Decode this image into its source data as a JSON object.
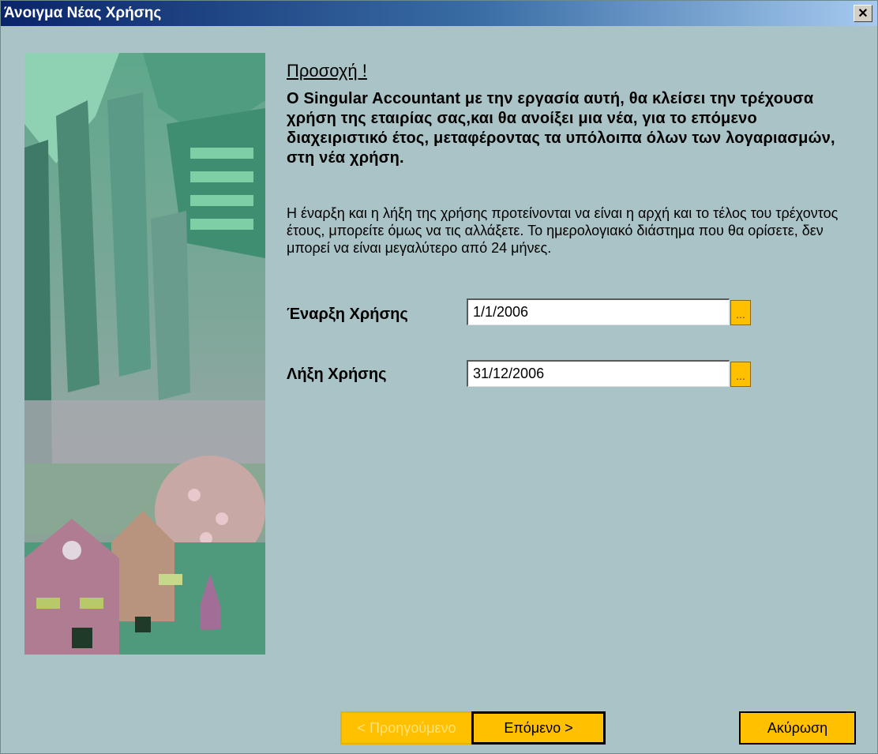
{
  "window": {
    "title": "Άνοιγμα Νέας Χρήσης",
    "close_label": "✕"
  },
  "warning": {
    "title": "Προσοχή !",
    "body": "Ο Singular Accountant με την εργασία αυτή, θα κλείσει την τρέχουσα χρήση της εταιρίας σας,και θα ανοίξει μια νέα, για το επόμενο διαχειριστικό έτος, μεταφέροντας τα υπόλοιπα όλων των λογαριασμών, στη νέα χρήση."
  },
  "info": "Η έναρξη και η λήξη της χρήσης προτείνονται να είναι η αρχή και το τέλος του τρέχοντος έτους, μπορείτε όμως να τις αλλάξετε. Το ημερολογιακό διάστημα που θα ορίσετε, δεν μπορεί να είναι μεγαλύτερο από 24 μήνες.",
  "fields": {
    "start": {
      "label": "Έναρξη Χρήσης",
      "value": "1/1/2006",
      "picker": "..."
    },
    "end": {
      "label": "Λήξη Χρήσης",
      "value": "31/12/2006",
      "picker": "..."
    }
  },
  "buttons": {
    "back": "< Προηγούμενο",
    "next": "Επόμενο >",
    "cancel": "Ακύρωση"
  },
  "colors": {
    "accent": "#ffc000",
    "background": "#a9c3c6",
    "title_start": "#0a246a"
  },
  "icons": {
    "side_image": "forest-houses-illustration",
    "close": "close-icon"
  }
}
